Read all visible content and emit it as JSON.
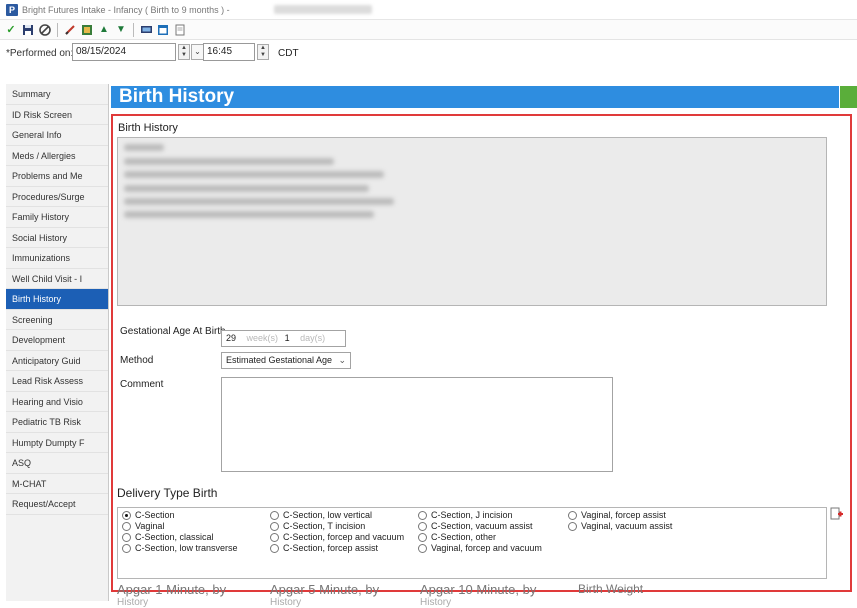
{
  "window": {
    "title": "Bright Futures Intake - Infancy ( Birth to 9 months ) -",
    "app_icon_letter": "P"
  },
  "toolbar": {
    "icons": [
      "checkmark-icon",
      "save-icon",
      "cancel-icon",
      "edit-icon",
      "document-icon",
      "up-arrow-icon",
      "down-arrow-icon",
      "monitor-icon",
      "calendar-icon",
      "print-preview-icon"
    ]
  },
  "performed": {
    "label": "*Performed on:",
    "date": "08/15/2024",
    "time": "16:45",
    "timezone": "CDT"
  },
  "sidebar": {
    "items": [
      {
        "label": "Summary"
      },
      {
        "label": "ID Risk Screen"
      },
      {
        "label": "General Info"
      },
      {
        "label": "Meds / Allergies"
      },
      {
        "label": "Problems and Me"
      },
      {
        "label": "Procedures/Surge"
      },
      {
        "label": "Family History"
      },
      {
        "label": "Social History"
      },
      {
        "label": "Immunizations"
      },
      {
        "label": "Well Child Visit - I"
      },
      {
        "label": "Birth History"
      },
      {
        "label": "Screening"
      },
      {
        "label": "Development"
      },
      {
        "label": "Anticipatory Guid"
      },
      {
        "label": "Lead Risk Assess"
      },
      {
        "label": "Hearing and Visio"
      },
      {
        "label": "Pediatric TB Risk"
      },
      {
        "label": "Humpty Dumpty F"
      },
      {
        "label": "ASQ"
      },
      {
        "label": "M-CHAT"
      },
      {
        "label": "Request/Accept"
      }
    ],
    "active_index": 10,
    "required_index": 7
  },
  "header": {
    "title": "Birth History"
  },
  "form": {
    "section_label": "Birth History",
    "gestational_age_label": "Gestational Age At Birth",
    "ga_weeks": "29",
    "ga_weeks_unit": "week(s)",
    "ga_days": "1",
    "ga_days_unit": "day(s)",
    "method_label": "Method",
    "method_value": "Estimated Gestational Age",
    "comment_label": "Comment",
    "comment_value": "",
    "delivery_type_title": "Delivery Type Birth",
    "delivery_options": [
      {
        "label": "C-Section",
        "selected": true
      },
      {
        "label": "Vaginal",
        "selected": false
      },
      {
        "label": "C-Section, classical",
        "selected": false
      },
      {
        "label": "C-Section, low transverse",
        "selected": false
      },
      {
        "label": "C-Section, low vertical",
        "selected": false
      },
      {
        "label": "C-Section, T incision",
        "selected": false
      },
      {
        "label": "C-Section, forcep and vacuum",
        "selected": false
      },
      {
        "label": "C-Section, forcep assist",
        "selected": false
      },
      {
        "label": "C-Section, J incision",
        "selected": false
      },
      {
        "label": "C-Section, vacuum assist",
        "selected": false
      },
      {
        "label": "C-Section, other",
        "selected": false
      },
      {
        "label": "Vaginal, forcep and vacuum",
        "selected": false
      },
      {
        "label": "Vaginal, forcep assist",
        "selected": false
      },
      {
        "label": "Vaginal, vacuum assist",
        "selected": false
      }
    ],
    "apgar_1": "Apgar 1 Minute, by",
    "apgar_5": "Apgar 5 Minute, by",
    "apgar_10": "Apgar 10 Minute, by",
    "birth_weight": "Birth Weight",
    "history_word": "History"
  },
  "colors": {
    "header_blue": "#2e8de0",
    "active_nav": "#1c5fb5",
    "highlight_red": "#e03a3a",
    "right_strip_green": "#5aae3a"
  }
}
